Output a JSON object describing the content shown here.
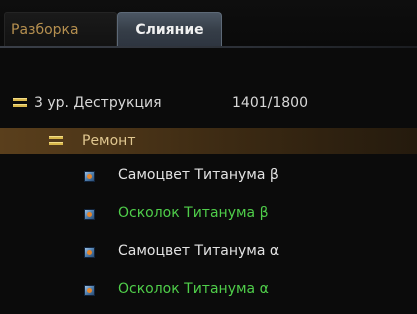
{
  "tabs": {
    "razborka": "Разборка",
    "sliyanie": "Слияние"
  },
  "tree": {
    "root": {
      "label": "3 ур. Деструкция",
      "progress": "1401/1800"
    },
    "group": {
      "label": "Ремонт"
    },
    "items": [
      {
        "label": "Самоцвет Титанума β",
        "color": "#e3e3e3",
        "icon": "gem-icon"
      },
      {
        "label": "Осколок Титанума β",
        "color": "#4fce4a",
        "icon": "gem-icon"
      },
      {
        "label": "Самоцвет Титанума α",
        "color": "#e3e3e3",
        "icon": "gem-icon"
      },
      {
        "label": "Осколок Титанума α",
        "color": "#4fce4a",
        "icon": "gem-icon"
      }
    ]
  },
  "colors": {
    "background": "#0b0b0b",
    "active_tab": "#3e4651",
    "inactive_tab_text": "#b58f4f",
    "group_highlight": "#5a3f1c",
    "collapse_icon": "#d9b84c"
  }
}
